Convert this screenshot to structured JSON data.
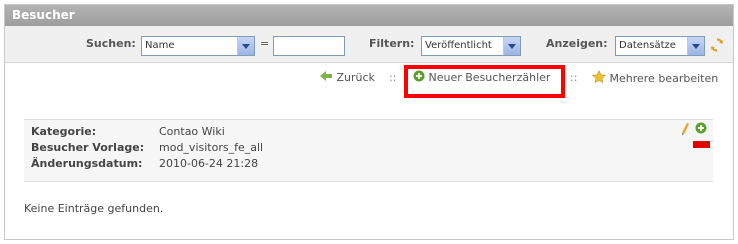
{
  "header": {
    "title": "Besucher"
  },
  "filters": {
    "search_label": "Suchen:",
    "search_field_value": "Name",
    "search_equals": "=",
    "search_query_value": "",
    "filter_label": "Filtern:",
    "filter_value": "Veröffentlicht",
    "show_label": "Anzeigen:",
    "show_value": "Datensätze"
  },
  "actions": {
    "back_label": "Zurück",
    "separator": "::",
    "new_label": "Neuer Besucherzähler",
    "edit_multiple_label": "Mehrere bearbeiten"
  },
  "record": {
    "fields": [
      {
        "label": "Kategorie:",
        "value": "Contao Wiki"
      },
      {
        "label": "Besucher Vorlage:",
        "value": "mod_visitors_fe_all"
      },
      {
        "label": "Änderungsdatum:",
        "value": "2010-06-24 21:28"
      }
    ]
  },
  "empty_message": "Keine Einträge gefunden.",
  "colors": {
    "highlight": "#ff0000",
    "titlebar": "#a8a8a8"
  }
}
